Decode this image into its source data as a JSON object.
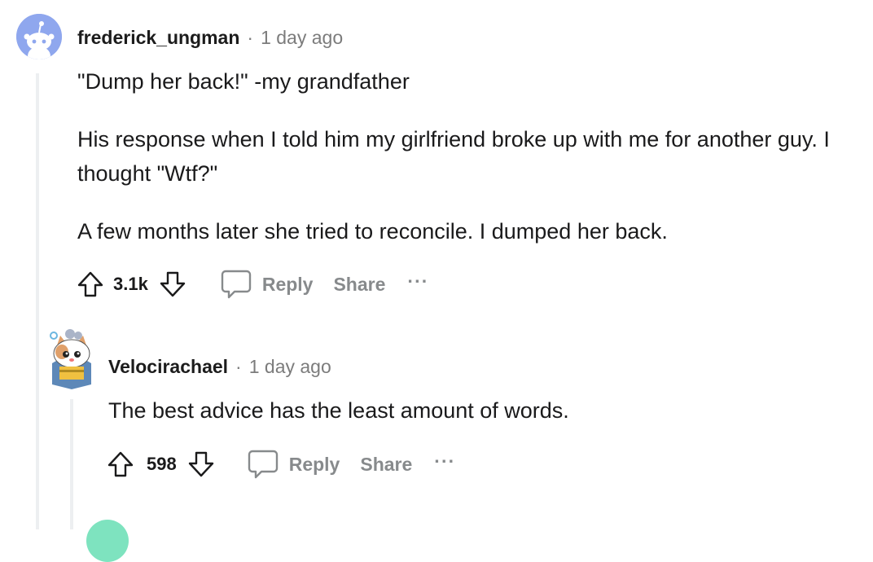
{
  "comments": [
    {
      "username": "frederick_ungman",
      "separator": "·",
      "time": "1 day ago",
      "paragraphs": [
        "\"Dump her back!\" -my grandfather",
        "His response when I told him my girlfriend broke up with me for another guy. I thought \"Wtf?\"",
        "A few months later she tried to reconcile. I dumped her back."
      ],
      "score": "3.1k",
      "reply_label": "Reply",
      "share_label": "Share",
      "more_label": "···"
    },
    {
      "username": "Velocirachael",
      "separator": "·",
      "time": "1 day ago",
      "paragraphs": [
        "The best advice has the least amount of words."
      ],
      "score": "598",
      "reply_label": "Reply",
      "share_label": "Share",
      "more_label": "···"
    }
  ],
  "colors": {
    "thread_line": "#edeff1",
    "meta_gray": "#7c7c7c",
    "action_gray": "#878a8c",
    "avatar_blue": "#8fa7ee",
    "avatar_teal": "#7ee3bf"
  },
  "icons": [
    "snoo-avatar",
    "cat-avatar",
    "upvote-icon",
    "downvote-icon",
    "comment-icon",
    "more-icon"
  ]
}
